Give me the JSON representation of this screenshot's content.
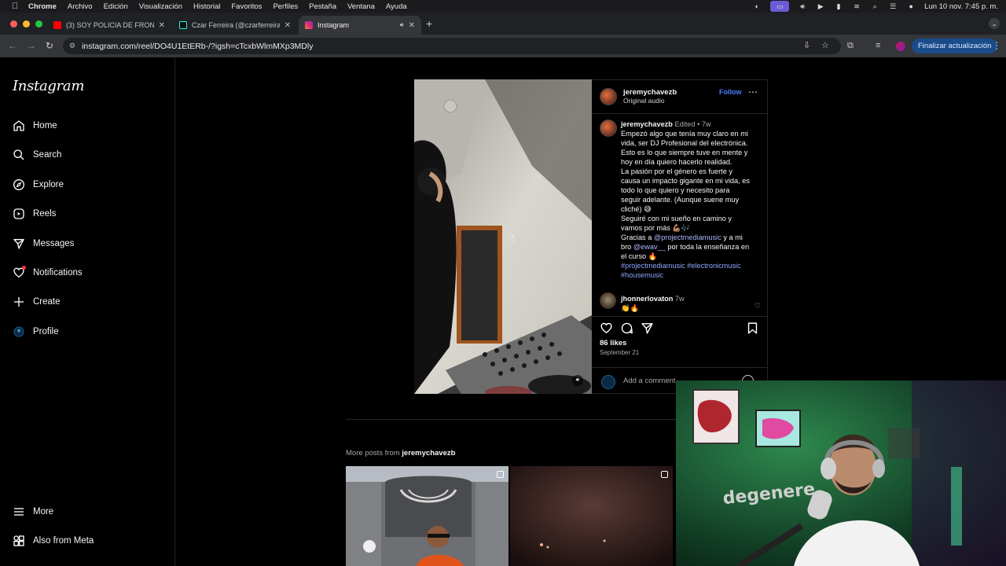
{
  "menubar": {
    "app": "Chrome",
    "items": [
      "Archivo",
      "Edición",
      "Visualización",
      "Historial",
      "Favoritos",
      "Perfiles",
      "Pestaña",
      "Ventana",
      "Ayuda"
    ],
    "clock": "Lun 10 nov.  7:45 p. m."
  },
  "tabs": [
    {
      "title": "(3) SOY POLICIA DE FRONTERA",
      "favicon": "youtube-icon",
      "color": "#ff0000"
    },
    {
      "title": "Czar Ferreira (@czarferreira)",
      "favicon": "tiktok-icon",
      "color": "#25f4ee"
    },
    {
      "title": "Instagram",
      "favicon": "instagram-icon",
      "color": "#dd2a7b",
      "active": true
    }
  ],
  "toolbar": {
    "url": "instagram.com/reel/DO4U1EtERb-/?igsh=cTcxbWlmMXp3MDly",
    "update_label": "Finalizar actualización"
  },
  "instagram": {
    "logo": "Instagram",
    "nav": [
      {
        "label": "Home",
        "icon": "home-icon"
      },
      {
        "label": "Search",
        "icon": "search-icon"
      },
      {
        "label": "Explore",
        "icon": "explore-icon"
      },
      {
        "label": "Reels",
        "icon": "reels-icon"
      },
      {
        "label": "Messages",
        "icon": "messages-icon"
      },
      {
        "label": "Notifications",
        "icon": "heart-icon"
      },
      {
        "label": "Create",
        "icon": "plus-icon"
      },
      {
        "label": "Profile",
        "icon": "profile-icon"
      }
    ],
    "bottom_nav": [
      {
        "label": "More",
        "icon": "menu-icon"
      },
      {
        "label": "Also from Meta",
        "icon": "meta-icon"
      }
    ],
    "post": {
      "username": "jeremychavezb",
      "follow_label": "Follow",
      "audio": "Original audio",
      "caption_meta": "Edited • 7w",
      "caption_lines": [
        "Empezó algo que tenía muy claro en mi",
        "vida, ser DJ Profesional del electrónica.",
        "Esto es lo que siempre tuve en mente y",
        "hoy en día quiero hacerlo realidad.",
        "La pasión por el género es fuerte y",
        "causa un impacto gigante en mi vida, es",
        "todo lo que quiero y necesito para",
        "seguir adelante. (Aunque suene muy",
        "cliché) 😅",
        "Seguiré con mi sueño en camino y",
        "vamos por más 💪🏽🎶"
      ],
      "thanks_prefix": "Gracias a ",
      "mention1": "@projectmediamusic",
      "thanks_mid": " y a mi",
      "thanks_line2_prefix": "bro ",
      "mention2": "@ewav__",
      "thanks_line2_suffix": " por toda la enseñanza en",
      "thanks_line3": "el curso 🔥",
      "hashtags_line1": "#projectmediamusic #electronicmusic",
      "hashtags_line2": "#housemusic",
      "comment": {
        "username": "jhonnerlovaton",
        "time": "7w",
        "text": "👏🔥"
      },
      "likes": "86 likes",
      "date": "September 21",
      "add_comment_placeholder": "Add a comment..."
    },
    "more_posts_prefix": "More posts from ",
    "more_posts_user": "jeremychavezb"
  },
  "webcam": {
    "wall_text": "degenere"
  }
}
